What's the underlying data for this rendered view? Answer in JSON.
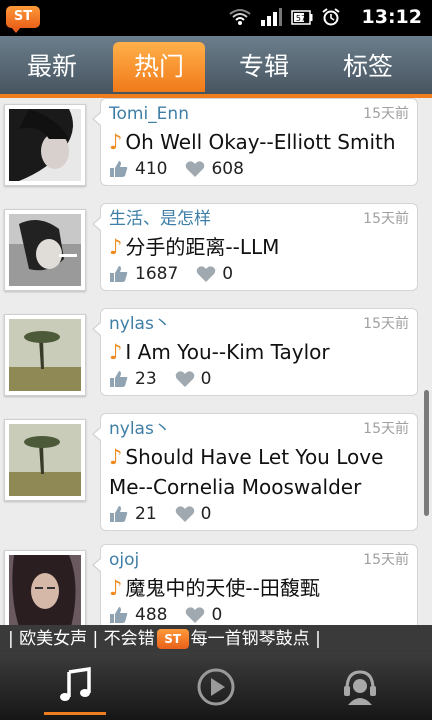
{
  "statusbar": {
    "logo": "ST",
    "time": "13:12",
    "battery": "57"
  },
  "tabs": [
    {
      "label": "最新",
      "active": false
    },
    {
      "label": "热门",
      "active": true
    },
    {
      "label": "专辑",
      "active": false
    },
    {
      "label": "标签",
      "active": false
    }
  ],
  "items": [
    {
      "user": "Tomi_Enn",
      "time": "15天前",
      "song": "Oh Well Okay--Elliott Smith",
      "likes": "410",
      "favs": "608"
    },
    {
      "user": "生活、是怎样",
      "time": "15天前",
      "song": "分手的距离--LLM",
      "likes": "1687",
      "favs": "0"
    },
    {
      "user": "nylas丶",
      "time": "15天前",
      "song": "I Am You--Kim Taylor",
      "likes": "23",
      "favs": "0"
    },
    {
      "user": "nylas丶",
      "time": "15天前",
      "song_line1": "Should Have Let You Love",
      "song_line2": "Me--Cornelia Mooswalder",
      "likes": "21",
      "favs": "0"
    },
    {
      "user": "ojoj",
      "time": "15天前",
      "song": "魔鬼中的天使--田馥甄",
      "likes": "488",
      "favs": "0"
    }
  ],
  "ticker": {
    "part1": "| 欧美女声 | 不会错",
    "logo": "ST",
    "part2": " 每一首钢琴鼓点 |"
  },
  "icons": [
    "music-note-icon",
    "play-icon",
    "headphones-user-icon"
  ],
  "colors": {
    "accent": "#ee7d1d",
    "link": "#3f7ea6"
  }
}
